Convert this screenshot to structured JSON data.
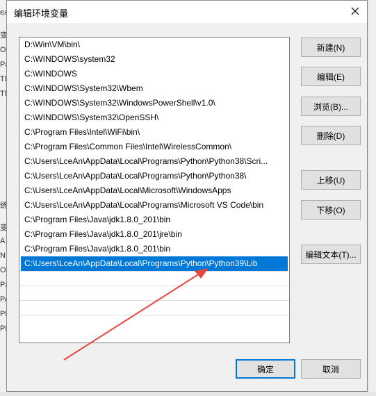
{
  "dialog": {
    "title": "编辑环境变量",
    "path_entries": [
      "D:\\Win\\VM\\bin\\",
      "C:\\WINDOWS\\system32",
      "C:\\WINDOWS",
      "C:\\WINDOWS\\System32\\Wbem",
      "C:\\WINDOWS\\System32\\WindowsPowerShell\\v1.0\\",
      "C:\\WINDOWS\\System32\\OpenSSH\\",
      "C:\\Program Files\\Intel\\WiFi\\bin\\",
      "C:\\Program Files\\Common Files\\Intel\\WirelessCommon\\",
      "C:\\Users\\LceAn\\AppData\\Local\\Programs\\Python\\Python38\\Scri...",
      "C:\\Users\\LceAn\\AppData\\Local\\Programs\\Python\\Python38\\",
      "C:\\Users\\LceAn\\AppData\\Local\\Microsoft\\WindowsApps",
      "C:\\Users\\LceAn\\AppData\\Local\\Programs\\Microsoft VS Code\\bin",
      "C:\\Program Files\\Java\\jdk1.8.0_201\\bin",
      "C:\\Program Files\\Java\\jdk1.8.0_201\\jre\\bin",
      "C:\\Program Files\\Java\\jdk1.8.0_201\\bin",
      "C:\\Users\\LceAn\\AppData\\Local\\Programs\\Python\\Python39\\Lib"
    ],
    "selected_index": 15,
    "buttons": {
      "new": "新建(N)",
      "edit": "编辑(E)",
      "browse": "浏览(B)...",
      "delete": "删除(D)",
      "move_up": "上移(U)",
      "move_down": "下移(O)",
      "edit_text": "编辑文本(T)...",
      "ok": "确定",
      "cancel": "取消"
    }
  },
  "background_window": {
    "fragments": [
      "eA",
      "变",
      "O",
      "Pa",
      "TE",
      "TN",
      "统",
      "变",
      "A",
      "N",
      "O",
      "Pa",
      "PA",
      "PF",
      "PF"
    ]
  },
  "colors": {
    "selection": "#0078d7",
    "annotation_arrow": "#e8453c"
  }
}
